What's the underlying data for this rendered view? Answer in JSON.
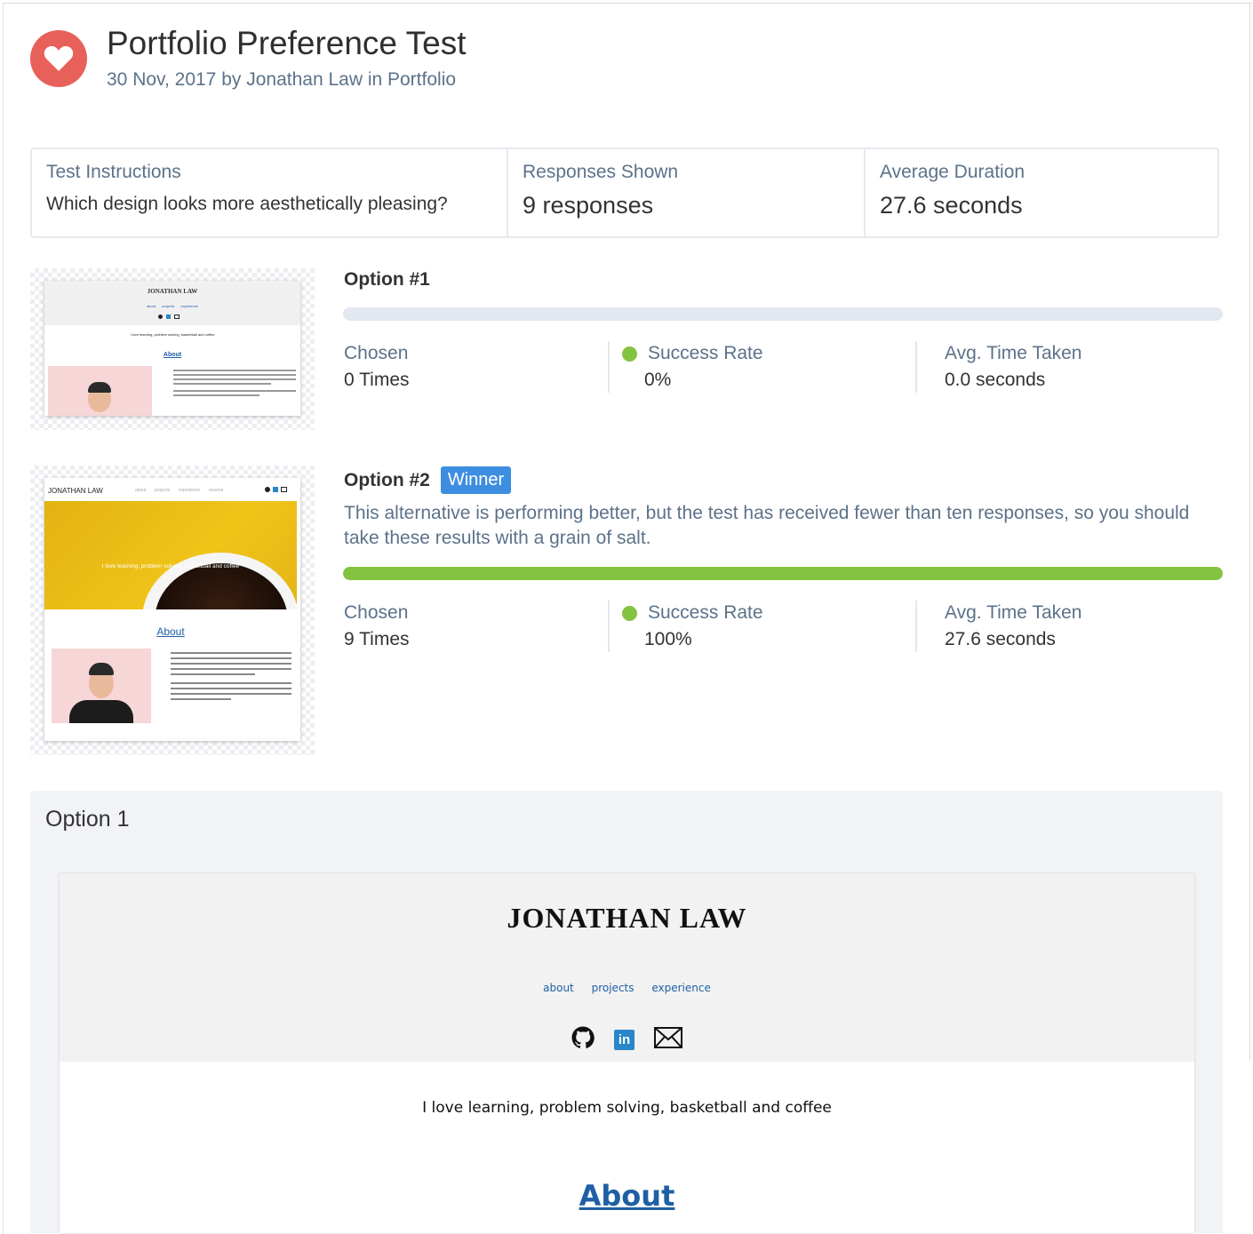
{
  "header": {
    "title": "Portfolio Preference Test",
    "subtitle": "30 Nov, 2017 by Jonathan Law in Portfolio",
    "icon": "heart-icon",
    "icon_color": "#e8605a"
  },
  "stats": {
    "instructions_label": "Test Instructions",
    "instructions_value": "Which design looks more aesthetically pleasing?",
    "responses_label": "Responses Shown",
    "responses_value": "9 responses",
    "duration_label": "Average Duration",
    "duration_value": "27.6 seconds"
  },
  "options": [
    {
      "title": "Option #1",
      "progress": 0,
      "chosen_label": "Chosen",
      "chosen_value": "0 Times",
      "success_label": "Success Rate",
      "success_value": "0%",
      "time_label": "Avg. Time Taken",
      "time_value": "0.0 seconds",
      "thumb": {
        "name": "JONATHAN LAW",
        "nav": [
          "about",
          "projects",
          "experience"
        ],
        "tagline": "I love learning, problem solving, basketball and coffee",
        "about": "About"
      }
    },
    {
      "title": "Option #2",
      "badge": "Winner",
      "note": "This alternative is performing better, but the test has received fewer than ten responses, so you should take these results with a grain of salt.",
      "progress": 1,
      "chosen_label": "Chosen",
      "chosen_value": "9 Times",
      "success_label": "Success Rate",
      "success_value": "100%",
      "time_label": "Avg. Time Taken",
      "time_value": "27.6 seconds",
      "thumb": {
        "name": "JONATHAN LAW",
        "nav": [
          "about",
          "projects",
          "experience",
          "resume"
        ],
        "tagline": "I love learning, problem solving, basketball and coffee",
        "about": "About"
      }
    }
  ],
  "colors": {
    "success": "#84c340",
    "badge": "#3d8ee0",
    "link": "#1f5fa5",
    "muted": "#5c7289"
  },
  "preview": {
    "panel_title": "Option 1",
    "site_name": "JONATHAN LAW",
    "nav": [
      "about",
      "projects",
      "experience"
    ],
    "icons": [
      "github-icon",
      "linkedin-icon",
      "mail-icon"
    ],
    "linkedin_text": "in",
    "tagline": "I love learning, problem solving, basketball and coffee",
    "about": "About"
  }
}
